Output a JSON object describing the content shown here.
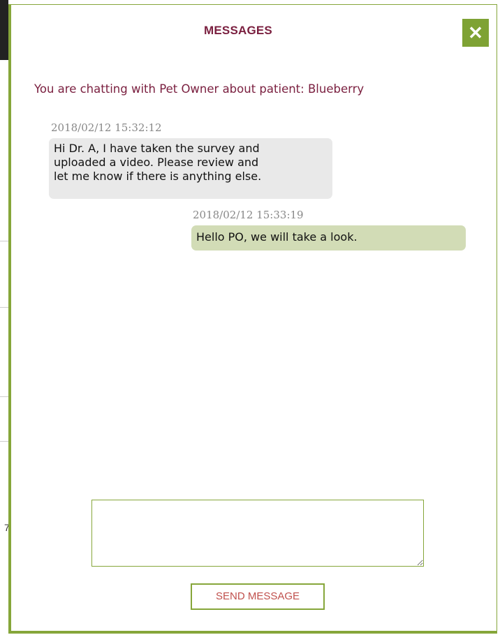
{
  "dialog": {
    "title": "MESSAGES",
    "close_icon": "close-icon",
    "close_glyph": "✕"
  },
  "chat_header": {
    "prefix": "You are chatting with ",
    "participant": "Pet Owner",
    "middle": " about patient: ",
    "patient": "Blueberry"
  },
  "messages": [
    {
      "direction": "received",
      "timestamp": "2018/02/12 15:32:12",
      "lines": [
        "Hi Dr. A, I have taken the survey and",
        "uploaded a video. Please review and",
        "let me know if there is anything else."
      ]
    },
    {
      "direction": "sent",
      "timestamp": "2018/02/12 15:33:19",
      "lines": [
        "Hello PO, we will take a look."
      ]
    }
  ],
  "composer": {
    "value": "",
    "placeholder": "",
    "send_label": "SEND MESSAGE"
  },
  "colors": {
    "accent_green": "#86a63a",
    "title_maroon": "#7a1f3f",
    "sent_bubble": "#d2dcb6",
    "received_bubble": "#e9e9e9",
    "send_label_red": "#c0504d"
  }
}
